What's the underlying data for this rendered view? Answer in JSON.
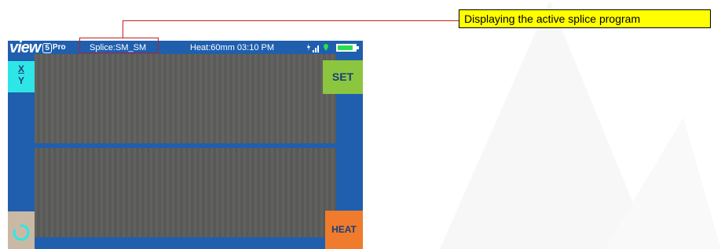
{
  "callout": {
    "text": "Displaying the active splice program"
  },
  "device": {
    "brand": {
      "name": "view",
      "model_number": "5",
      "model_suffix": "Pro"
    },
    "status_bar": {
      "splice_program": "Splice:SM_SM",
      "heat_info": "Heat:60mm 03:10 PM",
      "battery_level": 0.85,
      "icons": [
        "lightning-icon",
        "signal-bars-icon",
        "location-pin-icon",
        "battery-icon"
      ]
    },
    "buttons": {
      "xy_top": "X",
      "xy_bottom": "Y",
      "set": "SET",
      "heat": "HEAT",
      "reset_icon": "refresh-icon"
    }
  },
  "colors": {
    "screen_blue": "#1f5fae",
    "xy_button": "#2fe6e6",
    "set_button": "#8cc63f",
    "heat_button": "#f07b2c",
    "reset_button": "#c9b9a4",
    "callout_fill": "#ffff00",
    "leader_line": "#c02020",
    "battery_fill": "#27e04a"
  }
}
